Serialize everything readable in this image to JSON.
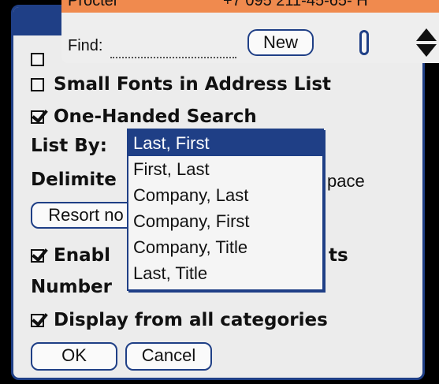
{
  "find_bar": {
    "record_name": "Procter",
    "record_phone": "+7 095 211-45-65- H",
    "find_label": "Find:",
    "new_button": "New"
  },
  "prefs": {
    "small_fonts_label": "Small Fonts in Address List",
    "small_fonts_checked": false,
    "one_handed_label": "One-Handed Search",
    "one_handed_checked": true,
    "list_by_label": "List By:",
    "delimiter_label": "Delimite",
    "delimiter_value_fragment": "pace",
    "resort_button": "Resort no",
    "enable_label": "Enabl",
    "enable_tail": "ts",
    "enable_checked": true,
    "number_label": "Number",
    "display_all_label": "Display from all categories",
    "display_all_checked": true,
    "ok_button": "OK",
    "cancel_button": "Cancel"
  },
  "list_by_popup": {
    "options": [
      "Last, First",
      "First, Last",
      "Company, Last",
      "Company, First",
      "Company, Title",
      "Last, Title"
    ],
    "selected": "Last, First"
  }
}
